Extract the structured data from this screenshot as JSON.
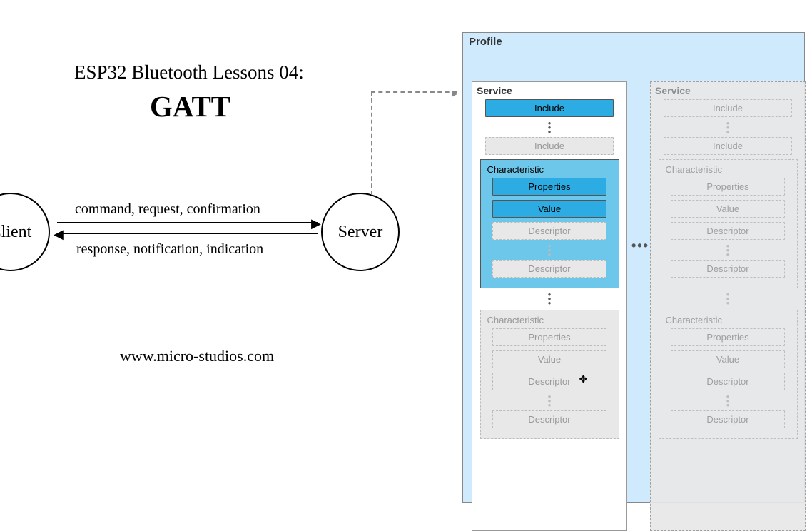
{
  "lesson": {
    "title": "ESP32 Bluetooth Lessons 04:",
    "heading": "GATT",
    "website": "www.micro-studios.com"
  },
  "actors": {
    "client": "Client",
    "server": "Server"
  },
  "arrows": {
    "to_server": "command, request, confirmation",
    "to_client": "response, notification, indication"
  },
  "profile": {
    "label": "Profile",
    "hdots": "•••",
    "service_active": {
      "label": "Service",
      "include_active": "Include",
      "include_ghost": "Include",
      "char_active": {
        "label": "Characteristic",
        "properties": "Properties",
        "value": "Value",
        "descriptor1": "Descriptor",
        "descriptor2": "Descriptor"
      },
      "char_ghost": {
        "label": "Characteristic",
        "properties": "Properties",
        "value": "Value",
        "descriptor1": "Descriptor",
        "descriptor2": "Descriptor"
      }
    },
    "service_ghost": {
      "label": "Service",
      "include1": "Include",
      "include2": "Include",
      "char1": {
        "label": "Characteristic",
        "properties": "Properties",
        "value": "Value",
        "descriptor1": "Descriptor",
        "descriptor2": "Descriptor"
      },
      "char2": {
        "label": "Characteristic",
        "properties": "Properties",
        "value": "Value",
        "descriptor1": "Descriptor",
        "descriptor2": "Descriptor"
      }
    }
  }
}
